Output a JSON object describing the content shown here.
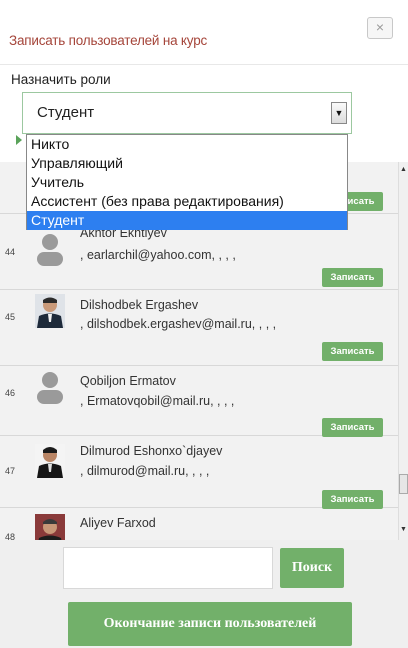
{
  "modal": {
    "title": "Записать пользователей на курс",
    "close_label": "×"
  },
  "roles": {
    "label": "Назначить роли",
    "selected": "Студент",
    "arrow": "▼",
    "options": [
      "Никто",
      "Управляющий",
      "Учитель",
      "Ассистент (без права редактирования)",
      "Студент"
    ]
  },
  "users": [
    {
      "index": "44",
      "name": "Akhtor Ekhtiyev",
      "email": ", earlarchil@yahoo.com, , , ,",
      "enroll_label": "Записать"
    },
    {
      "index": "45",
      "name": "Dilshodbek Ergashev",
      "email": ", dilshodbek.ergashev@mail.ru, , , ,",
      "enroll_label": "Записать"
    },
    {
      "index": "46",
      "name": "Qobiljon Ermatov",
      "email": ", Ermatovqobil@mail.ru, , , ,",
      "enroll_label": "Записать"
    },
    {
      "index": "47",
      "name": "Dilmurod Eshonxo`djayev",
      "email": ", dilmurod@mail.ru, , , ,",
      "enroll_label": "Записать"
    },
    {
      "index": "48",
      "name": "Aliyev Farxod",
      "email": "",
      "enroll_label": ""
    }
  ],
  "top_partial_enroll": "Записать",
  "scrollbar": {
    "up": "▲",
    "down": "▼"
  },
  "search": {
    "placeholder": "",
    "button_label": "Поиск"
  },
  "finish": {
    "label": "Окончание записи пользователей"
  },
  "colors": {
    "accent_green": "#72b06a",
    "title_red": "#a5453a",
    "selected_blue": "#2d7ff0"
  }
}
